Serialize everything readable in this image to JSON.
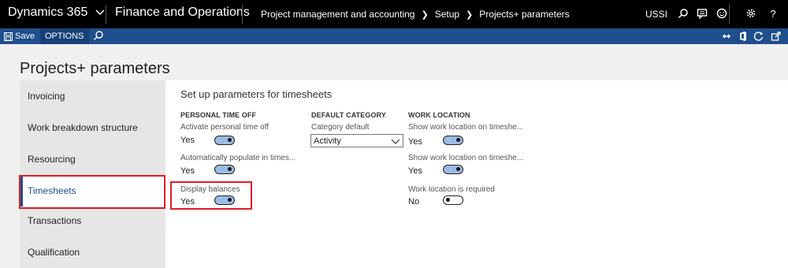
{
  "topbar": {
    "app_name": "Dynamics 365",
    "module": "Finance and Operations",
    "breadcrumb": [
      "Project management and accounting",
      "Setup",
      "Projects+ parameters"
    ],
    "company": "USSI"
  },
  "actionbar": {
    "save_label": "Save",
    "options_label": "OPTIONS"
  },
  "page": {
    "title": "Projects+ parameters"
  },
  "sidebar": {
    "items": [
      {
        "label": "Invoicing"
      },
      {
        "label": "Work breakdown structure"
      },
      {
        "label": "Resourcing"
      },
      {
        "label": "Timesheets"
      },
      {
        "label": "Transactions"
      },
      {
        "label": "Qualification"
      }
    ],
    "active_index": 3
  },
  "main": {
    "section_title": "Set up parameters for timesheets",
    "personal_time_off": {
      "title": "PERSONAL TIME OFF",
      "fields": [
        {
          "label": "Activate personal time off",
          "value": "Yes",
          "on": true
        },
        {
          "label": "Automatically populate in times...",
          "value": "Yes",
          "on": true
        },
        {
          "label": "Display balances",
          "value": "Yes",
          "on": true
        }
      ]
    },
    "default_category": {
      "title": "DEFAULT CATEGORY",
      "label": "Category default",
      "value": "Activity"
    },
    "work_location": {
      "title": "WORK LOCATION",
      "fields": [
        {
          "label": "Show work location on timeshe...",
          "value": "Yes",
          "on": true
        },
        {
          "label": "Show work location on timeshe...",
          "value": "Yes",
          "on": true
        },
        {
          "label": "Work location is required",
          "value": "No",
          "on": false
        }
      ]
    }
  },
  "colors": {
    "topbar": "#000000",
    "actionbar": "#1f4e8c",
    "toggle_on": "#9bbce6",
    "highlight": "#e01e26"
  }
}
